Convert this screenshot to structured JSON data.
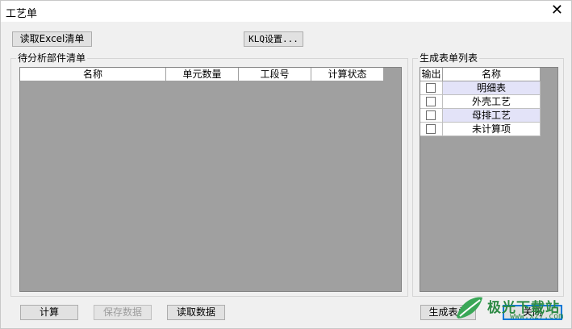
{
  "window": {
    "title": "工艺单",
    "close_glyph": "✕"
  },
  "toolbar": {
    "read_excel": "读取Excel清单",
    "klq_settings": "KLQ设置..."
  },
  "left_panel": {
    "title": "待分析部件清单",
    "columns": [
      "名称",
      "单元数量",
      "工段号",
      "计算状态"
    ]
  },
  "right_panel": {
    "title": "生成表单列表",
    "columns": [
      "输出",
      "名称"
    ],
    "rows": [
      {
        "name": "明细表",
        "checked": false,
        "highlighted": true
      },
      {
        "name": "外壳工艺",
        "checked": false,
        "highlighted": false
      },
      {
        "name": "母排工艺",
        "checked": false,
        "highlighted": true
      },
      {
        "name": "未计算项",
        "checked": false,
        "highlighted": false
      }
    ]
  },
  "bottom": {
    "calculate": "计算",
    "save_data": "保存数据",
    "read_data": "读取数据",
    "generate_forms": "生成表单",
    "close": "关闭"
  },
  "watermark": {
    "text": "极光下载站",
    "sub": "www.xz7.com",
    "color": "#2d8a44"
  }
}
